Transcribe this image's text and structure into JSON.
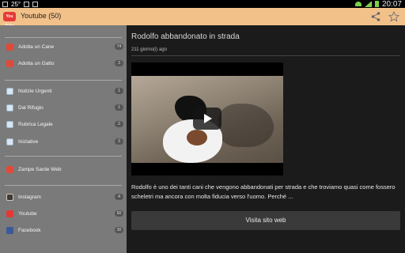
{
  "status_bar": {
    "temperature": "25°",
    "time": "20:07"
  },
  "app": {
    "title": "Youtube (50)",
    "icon_text": "You Tube"
  },
  "sidebar": {
    "items": [
      {
        "label": "Adotta un Cane",
        "count": "74",
        "icon": "dog-icon"
      },
      {
        "label": "Adotta un Gatto",
        "count": "3",
        "icon": "cat-icon"
      },
      {
        "label": "Notizie Urgenti",
        "count": "1",
        "icon": "document-icon"
      },
      {
        "label": "Dal Rifugio",
        "count": "1",
        "icon": "document-icon"
      },
      {
        "label": "Rubrica Legale",
        "count": "2",
        "icon": "document-icon"
      },
      {
        "label": "Iniziative",
        "count": "3",
        "icon": "document-icon"
      },
      {
        "label": "Zampe Sarde Web",
        "count": "",
        "icon": "paw-icon"
      },
      {
        "label": "Instagram",
        "count": "4",
        "icon": "instagram-icon"
      },
      {
        "label": "Youtube",
        "count": "50",
        "icon": "youtube-icon"
      },
      {
        "label": "Facebook",
        "count": "30",
        "icon": "facebook-icon"
      }
    ]
  },
  "post": {
    "title": "Rodolfo abbandonato in strada",
    "date": "211 giorno(i) ago",
    "description": "Rodolfo è uno dei tanti cani che vengono abbandonati per strada e che troviamo quasi come fossero scheletri ma ancora con molta fiducia verso l'uomo. Perché ...",
    "visit_button": "Visita sito web"
  },
  "colors": {
    "action_bar": "#f2c18a",
    "sidebar": "#7a7a7a",
    "content_bg": "#1b1b1b"
  }
}
